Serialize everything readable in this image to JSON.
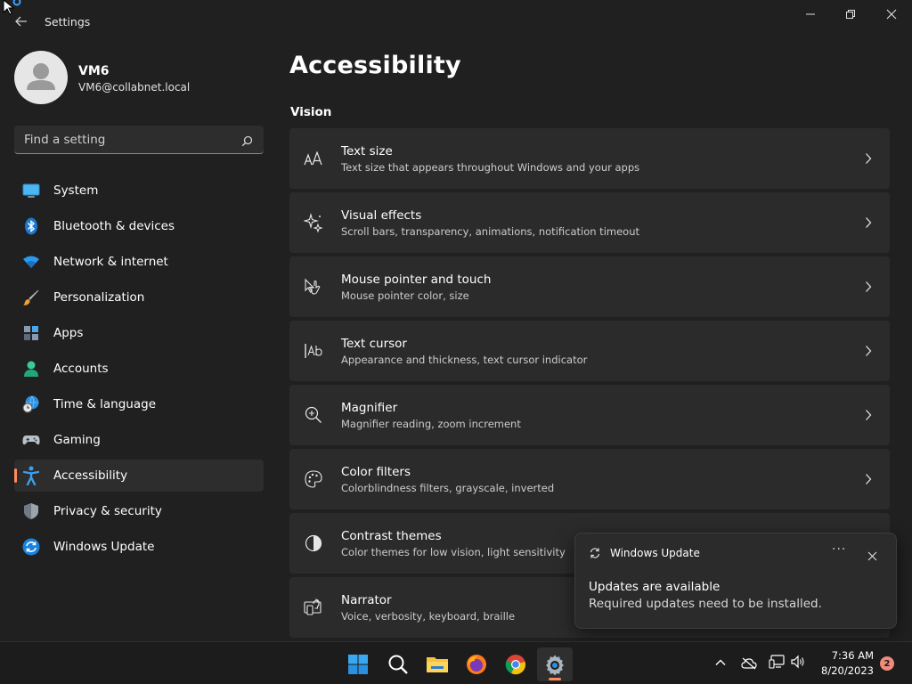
{
  "window": {
    "title": "Settings",
    "controls": [
      "minimize",
      "maximize",
      "close"
    ]
  },
  "profile": {
    "name": "VM6",
    "email": "VM6@collabnet.local"
  },
  "search": {
    "placeholder": "Find a setting"
  },
  "sidebar": {
    "items": [
      {
        "label": "System",
        "icon": "system-icon"
      },
      {
        "label": "Bluetooth & devices",
        "icon": "bluetooth-icon"
      },
      {
        "label": "Network & internet",
        "icon": "wifi-icon"
      },
      {
        "label": "Personalization",
        "icon": "brush-icon"
      },
      {
        "label": "Apps",
        "icon": "apps-icon"
      },
      {
        "label": "Accounts",
        "icon": "account-icon"
      },
      {
        "label": "Time & language",
        "icon": "globe-clock-icon"
      },
      {
        "label": "Gaming",
        "icon": "gamepad-icon"
      },
      {
        "label": "Accessibility",
        "icon": "accessibility-icon",
        "active": true
      },
      {
        "label": "Privacy & security",
        "icon": "shield-icon"
      },
      {
        "label": "Windows Update",
        "icon": "update-icon"
      }
    ]
  },
  "main": {
    "title": "Accessibility",
    "section": "Vision",
    "cards": [
      {
        "title": "Text size",
        "subtitle": "Text size that appears throughout Windows and your apps",
        "icon": "text-size-icon"
      },
      {
        "title": "Visual effects",
        "subtitle": "Scroll bars, transparency, animations, notification timeout",
        "icon": "sparkle-icon"
      },
      {
        "title": "Mouse pointer and touch",
        "subtitle": "Mouse pointer color, size",
        "icon": "pointer-touch-icon"
      },
      {
        "title": "Text cursor",
        "subtitle": "Appearance and thickness, text cursor indicator",
        "icon": "text-cursor-icon"
      },
      {
        "title": "Magnifier",
        "subtitle": "Magnifier reading, zoom increment",
        "icon": "magnifier-icon"
      },
      {
        "title": "Color filters",
        "subtitle": "Colorblindness filters, grayscale, inverted",
        "icon": "palette-icon"
      },
      {
        "title": "Contrast themes",
        "subtitle": "Color themes for low vision, light sensitivity",
        "icon": "contrast-icon"
      },
      {
        "title": "Narrator",
        "subtitle": "Voice, verbosity, keyboard, braille",
        "icon": "narrator-icon"
      }
    ]
  },
  "toast": {
    "app": "Windows Update",
    "more": "···",
    "heading": "Updates are available",
    "body": "Required updates need to be installed."
  },
  "taskbar": {
    "apps": [
      "start-icon",
      "search-icon",
      "file-explorer-icon",
      "firefox-icon",
      "chrome-icon",
      "settings-icon"
    ],
    "time": "7:36 AM",
    "date": "8/20/2023",
    "notification_count": "2"
  },
  "colors": {
    "background": "#202020",
    "card": "#2b2b2b",
    "accent": "#ff8a5c",
    "taskbar": "#1c1c1c"
  }
}
